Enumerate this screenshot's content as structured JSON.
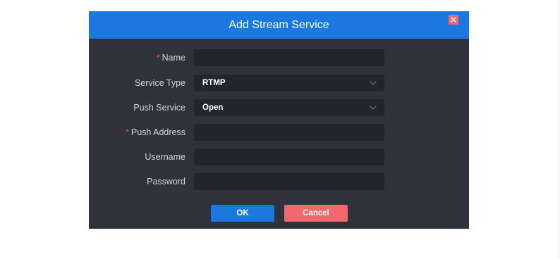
{
  "dialog": {
    "title": "Add Stream Service",
    "close_icon": "close-icon",
    "colors": {
      "header": "#1a78e0",
      "body": "#2f323b",
      "field": "#22252c",
      "close": "#f2686e",
      "cancel": "#f2686e",
      "ok": "#1a78e0",
      "required": "#e65a5a"
    }
  },
  "form": {
    "name": {
      "required_mark": "*",
      "label": "Name",
      "value": ""
    },
    "service_type": {
      "label": "Service Type",
      "value": "RTMP",
      "icon": "chevron-down-icon"
    },
    "push_service": {
      "label": "Push Service",
      "value": "Open",
      "icon": "chevron-down-icon"
    },
    "push_address": {
      "required_mark": "*",
      "label": "Push Address",
      "value": ""
    },
    "username": {
      "label": "Username",
      "value": ""
    },
    "password": {
      "label": "Password",
      "value": ""
    }
  },
  "buttons": {
    "ok_label": "OK",
    "cancel_label": "Cancel"
  }
}
